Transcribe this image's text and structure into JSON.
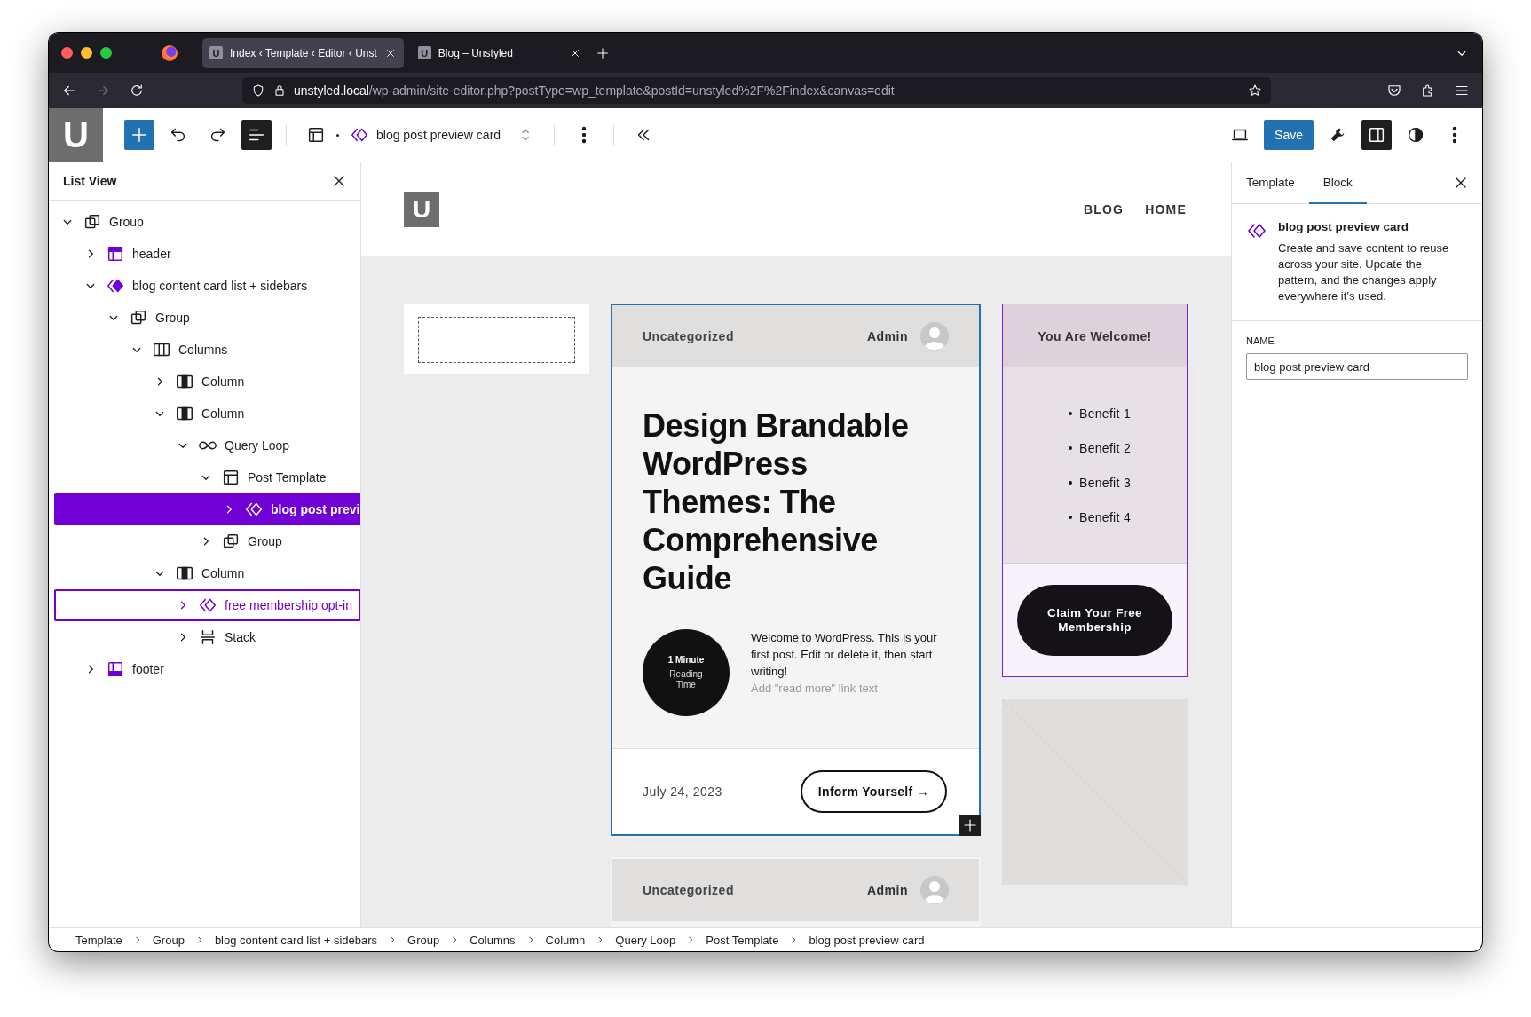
{
  "browser": {
    "tabs": [
      {
        "favicon": "U",
        "title": "Index ‹ Template ‹ Editor ‹ Unst",
        "selected": true
      },
      {
        "favicon": "U",
        "title": "Blog – Unstyled",
        "selected": false
      }
    ],
    "url": "**unstyled.local**/wp-admin/site-editor.php?postType=wp_template&postId=unstyled%2F%2Findex&canvas=edit"
  },
  "toolbar": {
    "logo": "U",
    "document_title": "blog post preview card",
    "list_view_open": true,
    "settings_open": true,
    "save": "Save"
  },
  "list_view": {
    "title": "List View",
    "items": [
      {
        "label": "Group",
        "kind": "group",
        "expanded": true,
        "selected": false,
        "highlighted": false,
        "children": [
          {
            "label": "header",
            "kind": "header",
            "expanded": false,
            "selected": false,
            "highlighted": false
          },
          {
            "label": "blog content card list + sidebars",
            "kind": "pattern-filled",
            "expanded": true,
            "selected": false,
            "highlighted": false,
            "children": [
              {
                "label": "Group",
                "kind": "group",
                "expanded": true,
                "selected": false,
                "highlighted": false,
                "children": [
                  {
                    "label": "Columns",
                    "kind": "columns",
                    "expanded": true,
                    "selected": false,
                    "highlighted": false,
                    "children": [
                      {
                        "label": "Column",
                        "kind": "column",
                        "expanded": false,
                        "selected": false,
                        "highlighted": false
                      },
                      {
                        "label": "Column",
                        "kind": "column",
                        "expanded": true,
                        "selected": false,
                        "highlighted": false,
                        "children": [
                          {
                            "label": "Query Loop",
                            "kind": "query",
                            "expanded": true,
                            "selected": false,
                            "highlighted": false,
                            "children": [
                              {
                                "label": "Post Template",
                                "kind": "template",
                                "expanded": true,
                                "selected": false,
                                "highlighted": false,
                                "children": [
                                  {
                                    "label": "blog post previ",
                                    "kind": "pattern",
                                    "expanded": false,
                                    "selected": true,
                                    "highlighted": false
                                  }
                                ]
                              },
                              {
                                "label": "Group",
                                "kind": "group",
                                "expanded": false,
                                "selected": false,
                                "highlighted": false
                              }
                            ]
                          }
                        ]
                      },
                      {
                        "label": "Column",
                        "kind": "column",
                        "expanded": true,
                        "selected": false,
                        "highlighted": false,
                        "children": [
                          {
                            "label": "free membership opt-in",
                            "kind": "pattern",
                            "expanded": false,
                            "selected": false,
                            "highlighted": true
                          },
                          {
                            "label": "Stack",
                            "kind": "stack",
                            "expanded": false,
                            "selected": false,
                            "highlighted": false
                          }
                        ]
                      }
                    ]
                  }
                ]
              }
            ]
          },
          {
            "label": "footer",
            "kind": "footer",
            "expanded": false,
            "selected": false,
            "highlighted": false
          }
        ]
      }
    ]
  },
  "canvas": {
    "site_logo": "U",
    "nav": [
      "BLOG",
      "HOME"
    ],
    "post": {
      "selected": true,
      "category": "Uncategorized",
      "author": "Admin",
      "title": "Design Brandable WordPress Themes: The Comprehensive Guide",
      "reading_time": "1 Minute",
      "reading_label": "Reading Time",
      "excerpt": "Welcome to WordPress. This is your first post. Edit or delete it, then start writing!",
      "read_more_placeholder": "Add \"read more\" link text",
      "date": "July 24, 2023",
      "button": "Inform Yourself →"
    },
    "sidebar": {
      "highlighted": true,
      "heading": "You Are Welcome!",
      "benefits": [
        "Benefit 1",
        "Benefit 2",
        "Benefit 3",
        "Benefit 4"
      ],
      "button": "Claim Your Free Membership"
    },
    "next_post": {
      "category": "Uncategorized",
      "author": "Admin"
    }
  },
  "inspector": {
    "tabs": [
      {
        "label": "Template",
        "selected": false
      },
      {
        "label": "Block",
        "selected": true
      }
    ],
    "block_title": "blog post preview card",
    "description": "Create and save content to reuse across your site. Update the pattern, and the changes apply everywhere it’s used.",
    "name_label": "NAME",
    "name_value": "blog post preview card"
  },
  "breadcrumbs": [
    "Template",
    "Group",
    "blog content card list + sidebars",
    "Group",
    "Columns",
    "Column",
    "Query Loop",
    "Post Template",
    "blog post preview card"
  ]
}
